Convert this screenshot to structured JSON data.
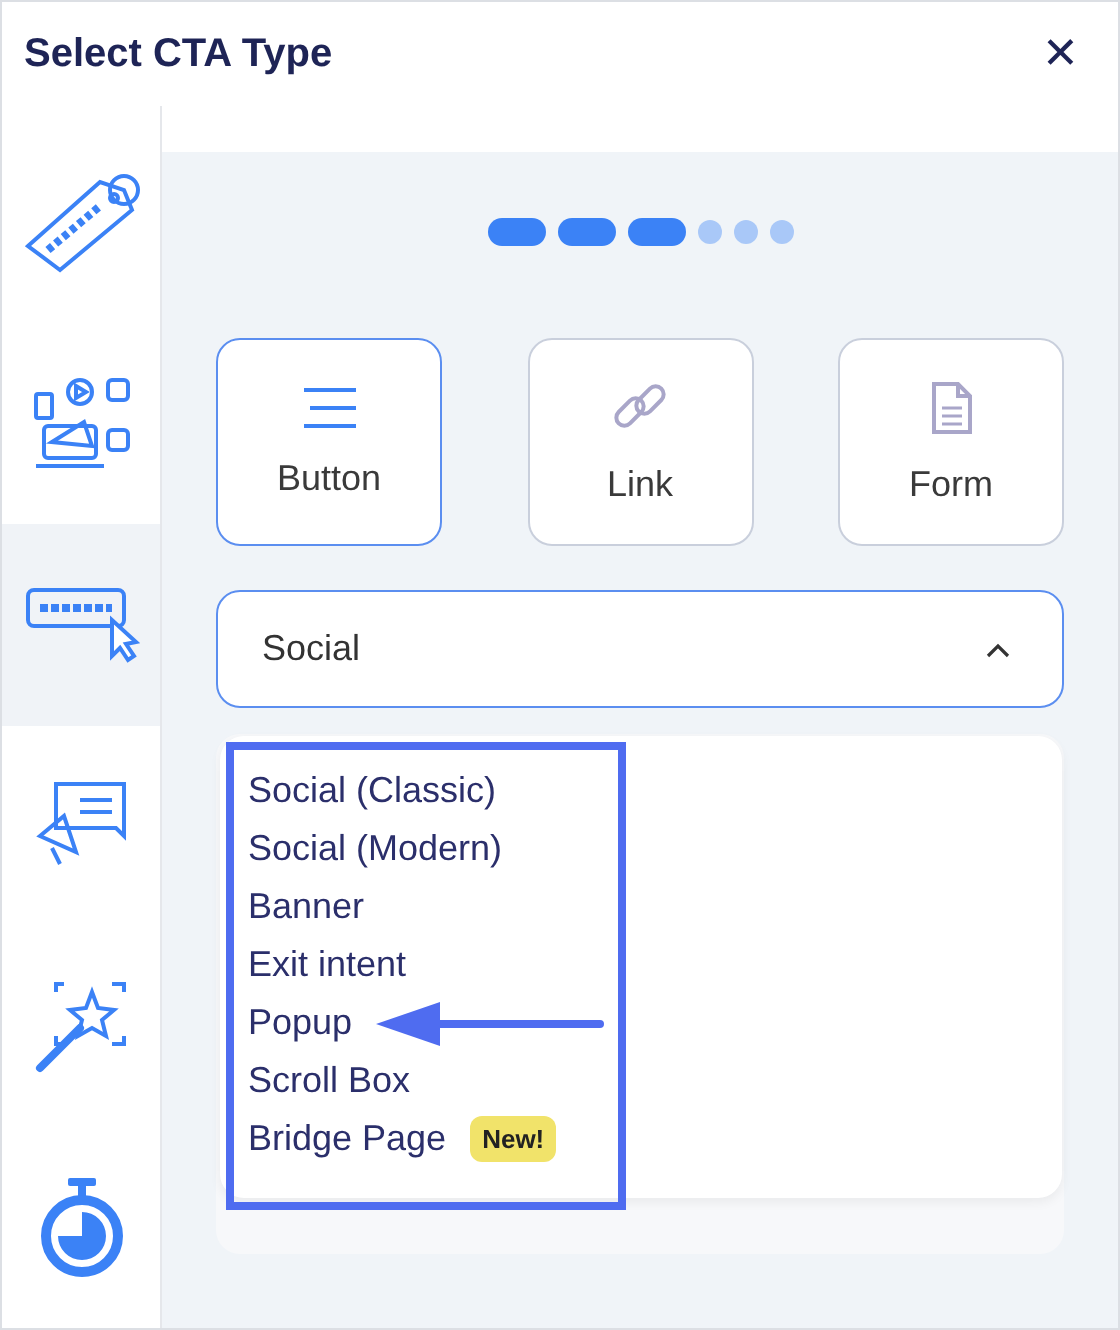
{
  "window": {
    "title": "Select CTA Type",
    "close": "✕"
  },
  "sidebar": {
    "items": [
      {
        "kind": "brand",
        "selected": false
      },
      {
        "kind": "social",
        "selected": false
      },
      {
        "kind": "action",
        "selected": true
      },
      {
        "kind": "message",
        "selected": false
      },
      {
        "kind": "magic",
        "selected": false
      },
      {
        "kind": "timer",
        "selected": false
      }
    ]
  },
  "stepper": [
    {
      "done": true
    },
    {
      "done": true
    },
    {
      "done": true
    },
    {
      "done": false
    },
    {
      "done": false
    },
    {
      "done": false
    }
  ],
  "cta_types": [
    {
      "kind": "button",
      "label": "Button",
      "selected": true
    },
    {
      "kind": "link",
      "label": "Link",
      "selected": false
    },
    {
      "kind": "form",
      "label": "Form",
      "selected": false
    }
  ],
  "dropdown": {
    "value": "Social",
    "expanded": true,
    "options": [
      {
        "label": "Social (Classic)",
        "highlighted": false
      },
      {
        "label": "Social (Modern)",
        "highlighted": false
      },
      {
        "label": "Banner",
        "highlighted": false
      },
      {
        "label": "Exit intent",
        "highlighted": false
      },
      {
        "label": "Popup",
        "highlighted": true
      },
      {
        "label": "Scroll Box",
        "highlighted": false
      },
      {
        "label": "Bridge Page",
        "highlighted": false,
        "badge": "New!"
      }
    ]
  }
}
